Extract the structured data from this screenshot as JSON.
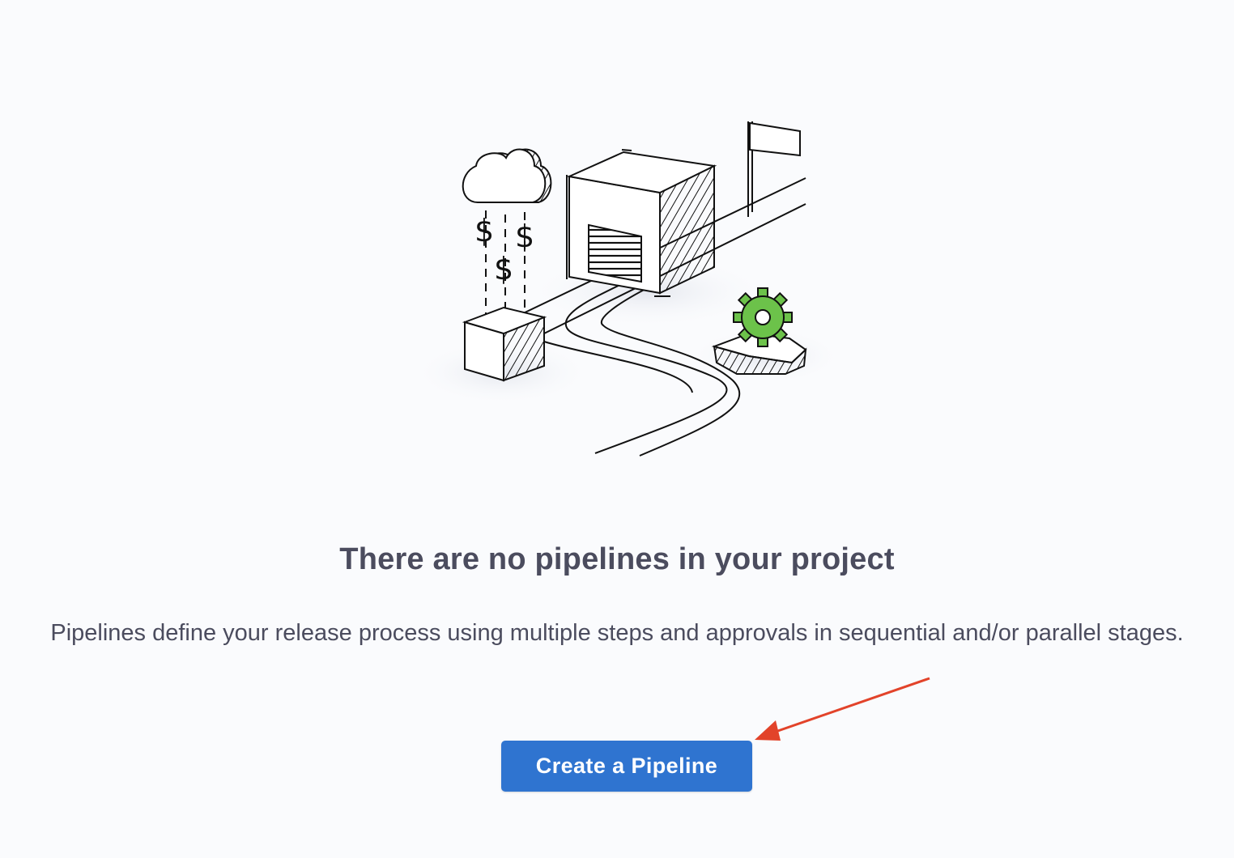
{
  "empty_state": {
    "illustration_icon": "pipeline-illustration",
    "title": "There are no pipelines in your project",
    "description": "Pipelines define your release process using multiple steps and approvals in sequential and/or parallel stages.",
    "cta_label": "Create a Pipeline",
    "dollar_symbol": "$"
  },
  "colors": {
    "background": "#fafbfd",
    "text": "#4b4c5e",
    "primary_button": "#2f74d0",
    "gear_green": "#6cc24a",
    "annotation_arrow": "#e2432a"
  }
}
